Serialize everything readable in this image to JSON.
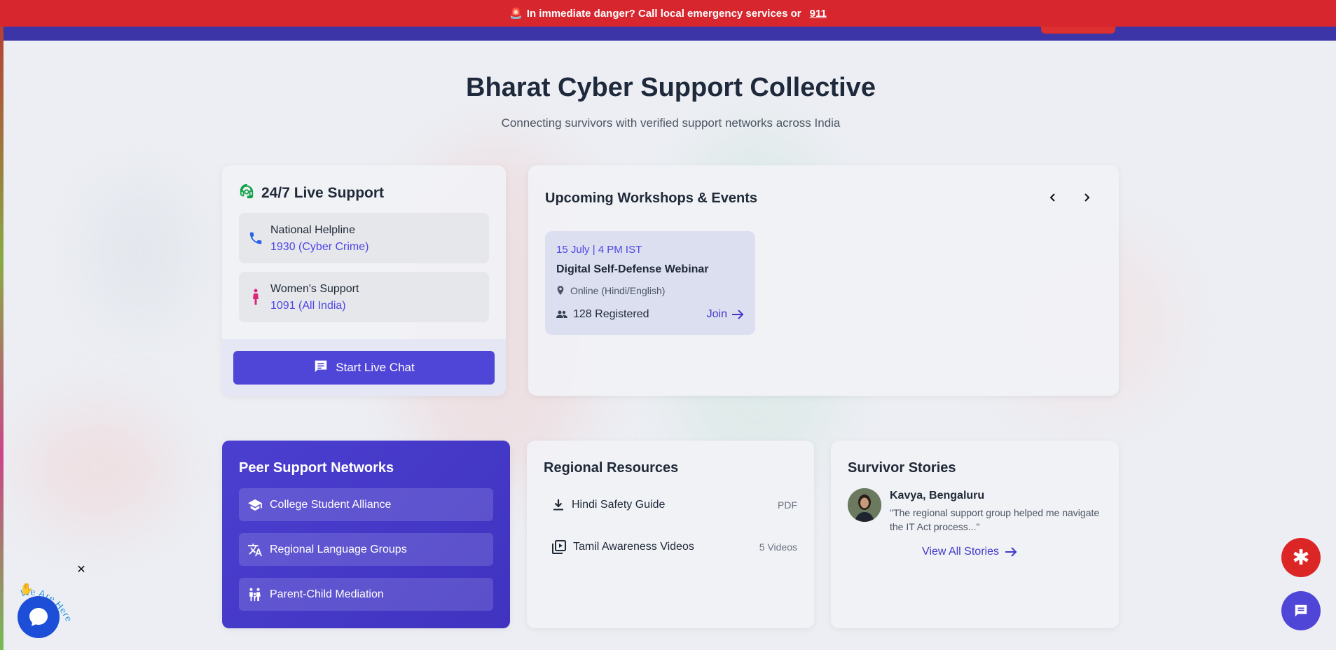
{
  "alert": {
    "icon": "siren-icon",
    "text": "In immediate danger? Call local emergency services or",
    "number": "911"
  },
  "hero": {
    "title": "Bharat Cyber Support Collective",
    "subtitle": "Connecting survivors with verified support networks across India"
  },
  "live_support": {
    "title": "24/7 Live Support",
    "helplines": [
      {
        "name": "National Helpline",
        "number": "1930 (Cyber Crime)",
        "icon": "phone-icon"
      },
      {
        "name": "Women's Support",
        "number": "1091 (All India)",
        "icon": "woman-icon"
      }
    ],
    "chat_button": "Start Live Chat"
  },
  "workshops": {
    "title": "Upcoming Workshops & Events",
    "events": [
      {
        "date": "15 July | 4 PM IST",
        "title": "Digital Self-Defense Webinar",
        "location": "Online (Hindi/English)",
        "registered": "128 Registered",
        "join": "Join"
      }
    ]
  },
  "peer": {
    "title": "Peer Support Networks",
    "items": [
      {
        "label": "College Student Alliance",
        "icon": "graduation-cap-icon"
      },
      {
        "label": "Regional Language Groups",
        "icon": "translate-icon"
      },
      {
        "label": "Parent-Child Mediation",
        "icon": "family-icon"
      }
    ]
  },
  "regional": {
    "title": "Regional Resources",
    "items": [
      {
        "label": "Hindi Safety Guide",
        "meta": "PDF",
        "icon": "download-icon"
      },
      {
        "label": "Tamil Awareness Videos",
        "meta": "5 Videos",
        "icon": "video-library-icon"
      }
    ]
  },
  "stories": {
    "title": "Survivor Stories",
    "name": "Kavya, Bengaluru",
    "quote": "\"The regional support group helped me navigate the IT Act process...\"",
    "link": "View All Stories"
  },
  "floating": {
    "emergency_symbol": "✱",
    "widget_close": "✕",
    "widget_tag": "We Are Here"
  },
  "colors": {
    "alert": "#d7262d",
    "nav": "#3b35a8",
    "primary": "#4f46d8",
    "link": "#4338ca"
  }
}
